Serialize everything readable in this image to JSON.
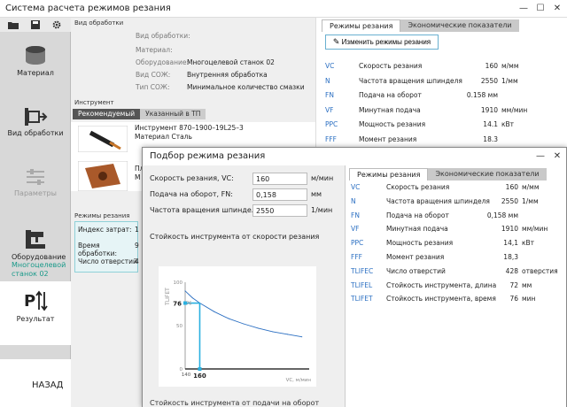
{
  "window": {
    "title": "Система расчета режимов резания"
  },
  "sidebar": {
    "items": [
      {
        "label": "Материал"
      },
      {
        "label": "Вид обработки"
      },
      {
        "label": "Параметры"
      },
      {
        "label": "Оборудование",
        "sub1": "Многоцелевой",
        "sub2": "станок 02"
      },
      {
        "label": "Результат"
      }
    ],
    "back_label": "НАЗАД"
  },
  "processing": {
    "title": "Вид обработки",
    "fields": [
      {
        "label": "Вид обработки:",
        "value": ""
      },
      {
        "label": "Материал:",
        "value": ""
      },
      {
        "label": "Оборудование:",
        "value": "Многоцелевой станок 02"
      },
      {
        "label": "Вид СОЖ:",
        "value": "Внутренняя обработка"
      },
      {
        "label": "Тип СОЖ:",
        "value": "Минимальное количество смазки"
      }
    ]
  },
  "tool": {
    "title": "Инструмент",
    "tabs": [
      "Рекомендуемый",
      "Указанный в ТП"
    ],
    "item1_line1": "Инструмент 870–1900–19L25–3",
    "item1_line2": "Материал Сталь",
    "item2_line1": "Пл",
    "item2_line2": "М"
  },
  "modes": {
    "title": "Режимы резания",
    "rows": [
      {
        "label": "Индекс затрат:",
        "value": "1"
      },
      {
        "label": "Время обработки:",
        "value": "9"
      },
      {
        "label": "Число отверстий",
        "value": "4"
      }
    ]
  },
  "right_panel": {
    "tabs": [
      "Режимы резания",
      "Экономические показатели"
    ],
    "change_button": "Изменить режимы резания",
    "params": [
      {
        "code": "VC",
        "name": "Скорость резания",
        "value": "160",
        "unit": "м/мм"
      },
      {
        "code": "N",
        "name": "Частота вращения шпинделя",
        "value": "2550",
        "unit": "1/мм"
      },
      {
        "code": "FN",
        "name": "Подача на оборот",
        "value": "0.158 мм",
        "unit": ""
      },
      {
        "code": "VF",
        "name": "Минутная подача",
        "value": "1910",
        "unit": "мм/мин"
      },
      {
        "code": "PPC",
        "name": "Мощность резания",
        "value": "14.1",
        "unit": "кВт"
      },
      {
        "code": "FFF",
        "name": "Момент резания",
        "value": "18.3",
        "unit": ""
      }
    ]
  },
  "dialog": {
    "title": "Подбор режима резания",
    "fields": [
      {
        "label": "Скорость резания, VC:",
        "value": "160",
        "unit": "м/мин"
      },
      {
        "label": "Подача на оборот, FN:",
        "value": "0,158",
        "unit": "мм"
      },
      {
        "label": "Частота вращения шпинделя, N:",
        "value": "2550",
        "unit": "1/мин"
      }
    ],
    "tabs": [
      "Режимы резания",
      "Экономические показатели"
    ],
    "params": [
      {
        "code": "VC",
        "name": "Скорость резания",
        "value": "160",
        "unit": "м/мм"
      },
      {
        "code": "N",
        "name": "Частота вращения шпинделя",
        "value": "2550",
        "unit": "1/мм"
      },
      {
        "code": "FN",
        "name": "Подача на оборот",
        "value": "0,158 мм",
        "unit": ""
      },
      {
        "code": "VF",
        "name": "Минутная подача",
        "value": "1910",
        "unit": "мм/мин"
      },
      {
        "code": "PPC",
        "name": "Мощность резания",
        "value": "14,1",
        "unit": "кВт"
      },
      {
        "code": "FFF",
        "name": "Момент резания",
        "value": "18,3",
        "unit": ""
      },
      {
        "code": "TLIFEC",
        "name": "Число отверстий",
        "value": "428",
        "unit": "отверстия"
      },
      {
        "code": "TLIFEL",
        "name": "Стойкость инструмента, длина",
        "value": "72",
        "unit": "мм"
      },
      {
        "code": "TLIFET",
        "name": "Стойкость инструмента, время",
        "value": "76",
        "unit": "мин"
      }
    ],
    "chart2_title": "Стойкость инструмента от подачи на оборот"
  },
  "chart_data": {
    "type": "line",
    "title": "Стойкость инструмента от скорости резания",
    "xlabel": "VC, м/мин",
    "ylabel": "TLIFET",
    "x": [
      140,
      150,
      160,
      180,
      200,
      220,
      240,
      260,
      280,
      300
    ],
    "y": [
      90,
      82,
      76,
      66,
      58,
      52,
      47,
      43,
      40,
      37
    ],
    "yticks": [
      "100",
      "50",
      "0"
    ],
    "xticks": [
      "140",
      "160"
    ],
    "marker": {
      "x": 160,
      "y": 76,
      "x_label": "160",
      "y_label": "76",
      "y_label2": "76"
    },
    "xlim": [
      140,
      310
    ],
    "ylim": [
      0,
      100
    ],
    "grid": false
  },
  "colors": {
    "accent": "#2ab0e0",
    "teal": "#1a9a8a",
    "code_blue": "#2b6fc2"
  }
}
